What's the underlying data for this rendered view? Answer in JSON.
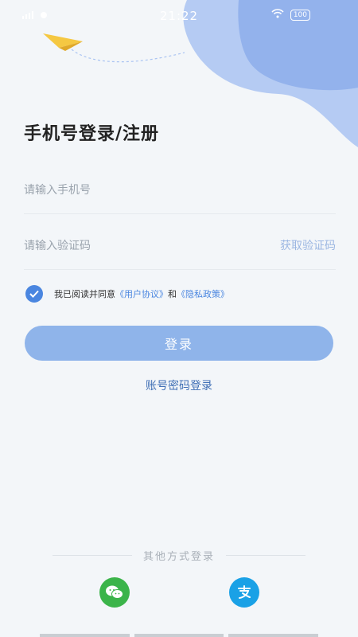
{
  "status_bar": {
    "time": "21:22",
    "battery": "100"
  },
  "page": {
    "title": "手机号登录/注册"
  },
  "form": {
    "phone_placeholder": "请输入手机号",
    "code_placeholder": "请输入验证码",
    "get_code_label": "获取验证码"
  },
  "agreement": {
    "prefix": "我已阅读并同意",
    "user_agreement": "《用户协议》",
    "and": "和",
    "privacy_policy": "《隐私政策》",
    "checked": true
  },
  "login_button": "登录",
  "password_login_link": "账号密码登录",
  "other_login": {
    "label": "其他方式登录",
    "options": [
      {
        "icon": "wechat-icon",
        "color": "#3bb44a"
      },
      {
        "icon": "alipay-icon",
        "color": "#1aa1e6"
      }
    ]
  },
  "colors": {
    "accent": "#4a86e0",
    "button": "#8fb4ea",
    "blob": "#a9c3f2"
  }
}
